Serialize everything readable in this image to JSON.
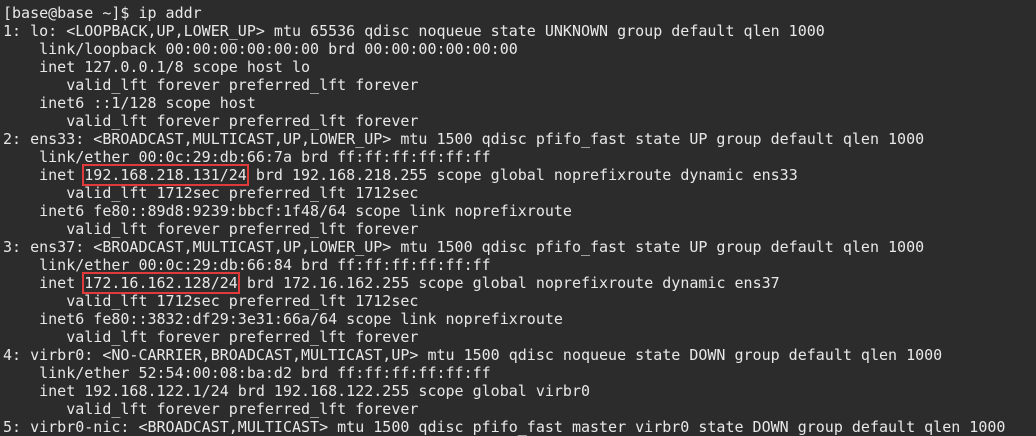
{
  "colors": {
    "background": "#2c2c2c",
    "text": "#e8e8e8",
    "highlight_box": "#e03a3a"
  },
  "terminal": {
    "lines": [
      {
        "text": "[base@base ~]$ ip addr"
      },
      {
        "text": "1: lo: <LOOPBACK,UP,LOWER_UP> mtu 65536 qdisc noqueue state UNKNOWN group default qlen 1000"
      },
      {
        "text": "    link/loopback 00:00:00:00:00:00 brd 00:00:00:00:00:00"
      },
      {
        "text": "    inet 127.0.0.1/8 scope host lo"
      },
      {
        "text": "       valid_lft forever preferred_lft forever"
      },
      {
        "text": "    inet6 ::1/128 scope host"
      },
      {
        "text": "       valid_lft forever preferred_lft forever"
      },
      {
        "text": "2: ens33: <BROADCAST,MULTICAST,UP,LOWER_UP> mtu 1500 qdisc pfifo_fast state UP group default qlen 1000"
      },
      {
        "text": "    link/ether 00:0c:29:db:66:7a brd ff:ff:ff:ff:ff:ff"
      },
      {
        "pre": "    inet ",
        "hl": "192.168.218.131/24",
        "post": " brd 192.168.218.255 scope global noprefixroute dynamic ens33"
      },
      {
        "text": "       valid_lft 1712sec preferred_lft 1712sec"
      },
      {
        "text": "    inet6 fe80::89d8:9239:bbcf:1f48/64 scope link noprefixroute"
      },
      {
        "text": "       valid_lft forever preferred_lft forever"
      },
      {
        "text": "3: ens37: <BROADCAST,MULTICAST,UP,LOWER_UP> mtu 1500 qdisc pfifo_fast state UP group default qlen 1000"
      },
      {
        "text": "    link/ether 00:0c:29:db:66:84 brd ff:ff:ff:ff:ff:ff"
      },
      {
        "pre": "    inet ",
        "hl": "172.16.162.128/24",
        "post": " brd 172.16.162.255 scope global noprefixroute dynamic ens37"
      },
      {
        "text": "       valid_lft 1712sec preferred_lft 1712sec"
      },
      {
        "text": "    inet6 fe80::3832:df29:3e31:66a/64 scope link noprefixroute"
      },
      {
        "text": "       valid_lft forever preferred_lft forever"
      },
      {
        "text": "4: virbr0: <NO-CARRIER,BROADCAST,MULTICAST,UP> mtu 1500 qdisc noqueue state DOWN group default qlen 1000"
      },
      {
        "text": "    link/ether 52:54:00:08:ba:d2 brd ff:ff:ff:ff:ff:ff"
      },
      {
        "text": "    inet 192.168.122.1/24 brd 192.168.122.255 scope global virbr0"
      },
      {
        "text": "       valid_lft forever preferred_lft forever"
      },
      {
        "text": "5: virbr0-nic: <BROADCAST,MULTICAST> mtu 1500 qdisc pfifo_fast master virbr0 state DOWN group default qlen 1000"
      }
    ]
  }
}
